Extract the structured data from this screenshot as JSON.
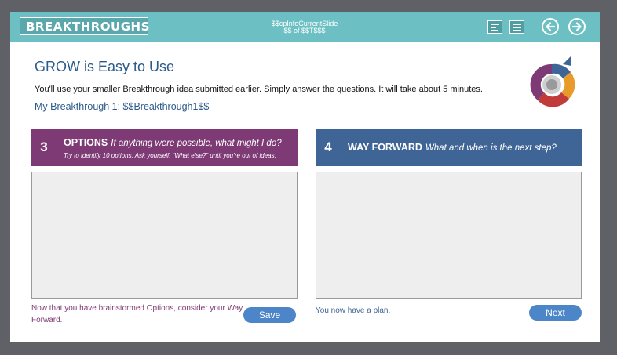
{
  "topbar": {
    "logo_text": "BREAKTHROUGHS",
    "slide_counter_line1": "$$cpInfoCurrentSlide",
    "slide_counter_line2": "$$ of $$T$$$",
    "icons": [
      "captions-icon",
      "menu-icon"
    ],
    "back_icon": "arrow-left-icon",
    "next_icon": "arrow-right-icon"
  },
  "main": {
    "title": "GROW is Easy to Use",
    "intro": "You'll use your smaller Breakthrough idea submitted earlier. Simply answer the questions. It will take about 5 minutes.",
    "subtitle": "My Breakthrough 1: $$Breakthrough1$$"
  },
  "panels": {
    "options": {
      "number": "3",
      "title": "OPTIONS",
      "question": "If anything were possible, what might I do?",
      "hint": "Try to identify 10 options. Ask yourself, “What else?” until you’re out of ideas.",
      "footnote": "Now that you have brainstormed Options, consider your Way Forward.",
      "button": "Save"
    },
    "way_forward": {
      "number": "4",
      "title": "WAY FORWARD",
      "question": "What and when is the next step?",
      "footnote": "You now have a plan.",
      "button": "Next"
    }
  },
  "colors": {
    "topbar": "#6cc0c4",
    "options": "#7e3a74",
    "way_forward": "#3f6496",
    "button": "#4d86c8",
    "title": "#2b5a8c"
  }
}
